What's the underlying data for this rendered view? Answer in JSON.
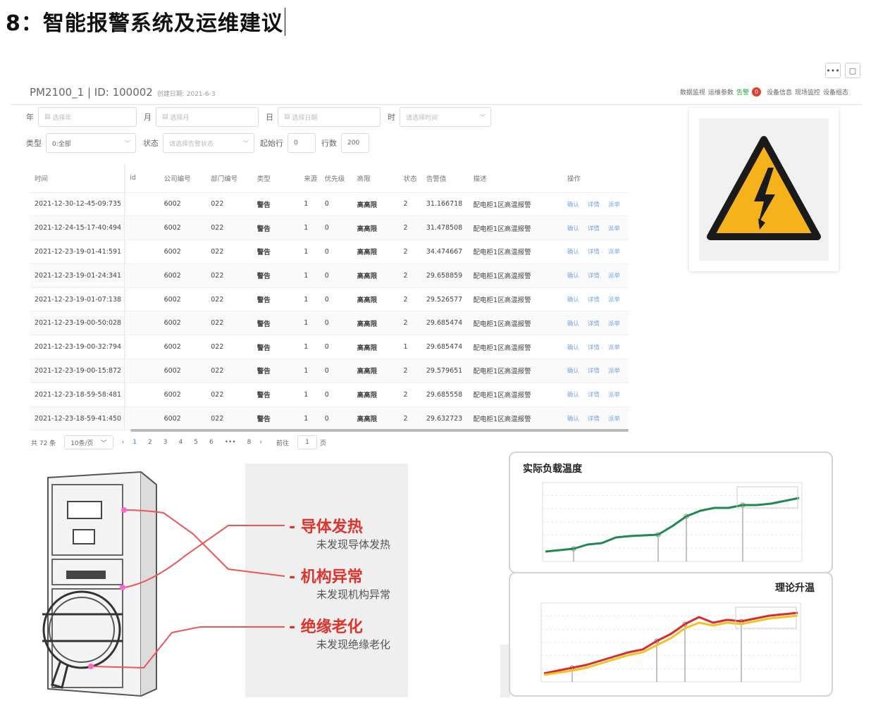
{
  "slide": {
    "title": "8：智能报警系统及运维建议"
  },
  "window": {
    "more_label": "•••",
    "square_label": "▢"
  },
  "header": {
    "device": "PM2100_1 | ID: 100002",
    "created": "创建日期: 2021-6-3",
    "nav": {
      "data_monitor": "数据监视",
      "ops_params": "运维参数",
      "alarm": "告警",
      "alarm_count": "0",
      "device_info": "设备信息",
      "site_monitor": "现场监控",
      "device_config": "设备组态"
    }
  },
  "filters": {
    "year_label": "年",
    "year_placeholder": "选择年",
    "month_label": "月",
    "month_placeholder": "选择月",
    "day_label": "日",
    "day_placeholder": "选择日期",
    "hour_label": "时",
    "hour_placeholder": "请选择时间",
    "type_label": "类型",
    "type_value": "0:全部",
    "status_label": "状态",
    "status_placeholder": "请选择告警状态",
    "start_label": "起始行",
    "start_value": "0",
    "rows_label": "行数",
    "rows_value": "200"
  },
  "table": {
    "headers": [
      "时间",
      "id",
      "公司编号",
      "部门编号",
      "类型",
      "来源",
      "优先级",
      "高限",
      "状态",
      "告警值",
      "描述",
      "操作"
    ],
    "actions": [
      "确认",
      "详情",
      "派单"
    ],
    "rows": [
      [
        "2021-12-30-12-45-09:735",
        "",
        "6002",
        "022",
        "警告",
        "1",
        "0",
        "高高限",
        "2",
        "31.166718",
        "配电柜1区高温报警"
      ],
      [
        "2021-12-24-15-17-40:494",
        "",
        "6002",
        "022",
        "警告",
        "1",
        "0",
        "高高限",
        "2",
        "31.478508",
        "配电柜1区高温报警"
      ],
      [
        "2021-12-23-19-01-41:591",
        "",
        "6002",
        "022",
        "警告",
        "1",
        "0",
        "高高限",
        "2",
        "34.474667",
        "配电柜1区高温报警"
      ],
      [
        "2021-12-23-19-01-24:341",
        "",
        "6002",
        "022",
        "警告",
        "1",
        "0",
        "高高限",
        "2",
        "29.658859",
        "配电柜1区高温报警"
      ],
      [
        "2021-12-23-19-01-07:138",
        "",
        "6002",
        "022",
        "警告",
        "1",
        "0",
        "高高限",
        "2",
        "29.526577",
        "配电柜1区高温报警"
      ],
      [
        "2021-12-23-19-00-50:028",
        "",
        "6002",
        "022",
        "警告",
        "1",
        "0",
        "高高限",
        "2",
        "29.685474",
        "配电柜1区高温报警"
      ],
      [
        "2021-12-23-19-00-32:794",
        "",
        "6002",
        "022",
        "警告",
        "1",
        "0",
        "高高限",
        "1",
        "29.685474",
        "配电柜1区高温报警"
      ],
      [
        "2021-12-23-19-00-15:872",
        "",
        "6002",
        "022",
        "警告",
        "1",
        "0",
        "高高限",
        "2",
        "29.579651",
        "配电柜1区高温报警"
      ],
      [
        "2021-12-23-18-59-58:481",
        "",
        "6002",
        "022",
        "警告",
        "1",
        "0",
        "高高限",
        "2",
        "29.685558",
        "配电柜1区高温报警"
      ],
      [
        "2021-12-23-18-59-41:450",
        "",
        "6002",
        "022",
        "警告",
        "1",
        "0",
        "高高限",
        "2",
        "29.632723",
        "配电柜1区高温报警"
      ]
    ]
  },
  "pager": {
    "total": "共 72 条",
    "page_size": "10条/页",
    "prev": "‹",
    "next": "›",
    "pages": [
      "1",
      "2",
      "3",
      "4",
      "5",
      "6",
      "•••",
      "8"
    ],
    "goto_label": "前往",
    "goto_value": "1",
    "goto_suffix": "页"
  },
  "cabinet": {
    "items": [
      {
        "title": "- 导体发热",
        "subtitle": "未发现导体发热"
      },
      {
        "title": "- 机构异常",
        "subtitle": "未发现机构异常"
      },
      {
        "title": "- 绝缘老化",
        "subtitle": "未发现绝缘老化"
      }
    ]
  },
  "colors": {
    "accent_red": "#e0322c",
    "green_line": "#1e8a4c",
    "red_line": "#d92b2b",
    "yellow_line": "#f2c423",
    "link_blue": "#2f7ff0",
    "warning_yellow": "#f6b21a"
  },
  "charts": {
    "chart1_title": "实际负载温度",
    "chart2_title": "理论升温"
  },
  "chart_data": [
    {
      "type": "line",
      "title": "实际负载温度",
      "x": [
        0,
        1,
        2,
        3,
        4,
        5,
        6,
        7,
        8,
        9,
        10,
        11,
        12,
        13,
        14,
        15,
        16,
        17,
        18
      ],
      "series": [
        {
          "values": [
            8,
            10,
            12,
            18,
            20,
            28,
            30,
            31,
            32,
            44,
            58,
            66,
            70,
            70,
            74,
            74,
            76,
            80,
            84
          ],
          "color": "#1e8a4c"
        }
      ],
      "ylim": [
        0,
        100
      ]
    },
    {
      "type": "line",
      "title": "理论升温",
      "x": [
        0,
        1,
        2,
        3,
        4,
        5,
        6,
        7,
        8,
        9,
        10,
        11,
        12,
        13,
        14,
        15,
        16,
        17,
        18
      ],
      "series": [
        {
          "values": [
            6,
            10,
            14,
            18,
            24,
            30,
            36,
            40,
            52,
            62,
            76,
            86,
            78,
            82,
            80,
            84,
            88,
            90,
            92
          ],
          "color": "#d92b2b"
        },
        {
          "values": [
            4,
            7,
            10,
            14,
            20,
            26,
            32,
            36,
            46,
            56,
            70,
            78,
            74,
            78,
            76,
            80,
            84,
            86,
            88
          ],
          "color": "#f2c423"
        }
      ],
      "ylim": [
        0,
        100
      ]
    }
  ]
}
